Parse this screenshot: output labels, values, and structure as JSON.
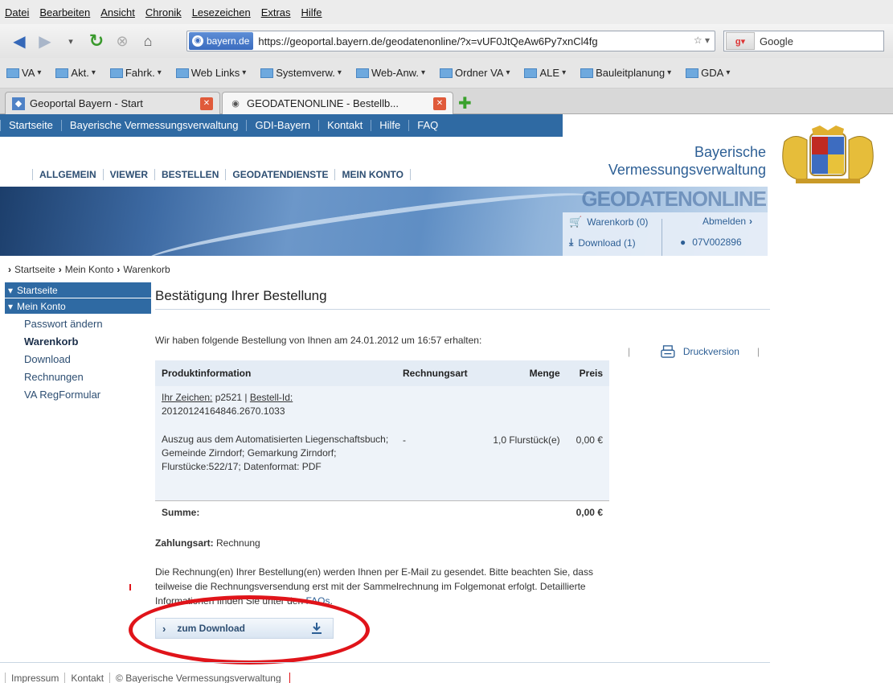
{
  "browser": {
    "menu": [
      {
        "label": "Datei"
      },
      {
        "label": "Bearbeiten"
      },
      {
        "label": "Ansicht"
      },
      {
        "label": "Chronik"
      },
      {
        "label": "Lesezeichen"
      },
      {
        "label": "Extras"
      },
      {
        "label": "Hilfe"
      }
    ],
    "site_badge": "bayern.de",
    "url": "https://geoportal.bayern.de/geodatenonline/?x=vUF0JtQeAw6Py7xnCl4fg",
    "search_engine": "Google",
    "bookmarks": [
      {
        "label": "VA"
      },
      {
        "label": "Akt."
      },
      {
        "label": "Fahrk."
      },
      {
        "label": "Web Links"
      },
      {
        "label": "Systemverw."
      },
      {
        "label": "Web-Anw."
      },
      {
        "label": "Ordner VA"
      },
      {
        "label": "ALE"
      },
      {
        "label": "Bauleitplanung"
      },
      {
        "label": "GDA"
      }
    ],
    "tabs": [
      {
        "title": "Geoportal Bayern - Start"
      },
      {
        "title": "GEODATENONLINE - Bestellb..."
      }
    ]
  },
  "page": {
    "topnav": [
      {
        "label": "Startseite"
      },
      {
        "label": "Bayerische Vermessungsverwaltung"
      },
      {
        "label": "GDI-Bayern"
      },
      {
        "label": "Kontakt"
      },
      {
        "label": "Hilfe"
      },
      {
        "label": "FAQ"
      }
    ],
    "logo": {
      "line1": "Bayerische",
      "line2": "Vermessungsverwaltung"
    },
    "mainnav": [
      {
        "label": "ALLGEMEIN"
      },
      {
        "label": "VIEWER"
      },
      {
        "label": "BESTELLEN"
      },
      {
        "label": "GEODATENDIENSTE"
      },
      {
        "label": "MEIN KONTO"
      }
    ],
    "banner": {
      "brand": "GEODATENONLINE",
      "cart": "Warenkorb (0)",
      "logout": "Abmelden",
      "download": "Download (1)",
      "user": "07V002896"
    },
    "breadcrumb": [
      "Startseite",
      "Mein Konto",
      "Warenkorb"
    ],
    "sidebar": {
      "head1": "Startseite",
      "head2": "Mein Konto",
      "items": [
        {
          "label": "Passwort ändern"
        },
        {
          "label": "Warenkorb"
        },
        {
          "label": "Download"
        },
        {
          "label": "Rechnungen"
        },
        {
          "label": "VA RegFormular"
        }
      ]
    },
    "content": {
      "title": "Bestätigung Ihrer Bestellung",
      "received": "Wir haben folgende Bestellung von Ihnen am 24.01.2012 um 16:57 erhalten:",
      "print": "Druckversion",
      "table": {
        "headers": {
          "product": "Produktinformation",
          "type": "Rechnungsart",
          "qty": "Menge",
          "price": "Preis"
        },
        "ref_label": "Ihr Zeichen:",
        "ref_value": " p2521 | ",
        "order_label": "Bestell-Id:",
        "order_id": "20120124164846.2670.1033",
        "product_desc": "Auszug aus dem Automatisierten Liegenschaftsbuch; Gemeinde Zirndorf; Gemarkung Zirndorf; Flurstücke:522/17; Datenformat: PDF",
        "type_value": "-",
        "qty_value": "1,0 Flurstück(e)",
        "price_value": "0,00 €",
        "sum_label": "Summe:",
        "sum_value": "0,00 €"
      },
      "payment_label": "Zahlungsart:",
      "payment_value": " Rechnung",
      "note_text": "Die Rechnung(en) Ihrer Bestellung(en) werden Ihnen per E-Mail zu gesendet. Bitte beachten Sie, dass teilweise die Rechnungsversendung erst mit der Sammelrechnung im Folgemonat erfolgt. Detaillierte Informationen finden Sie unter den ",
      "note_link": "FAQs",
      "note_end": ".",
      "download_button": "zum Download"
    },
    "footer": [
      {
        "label": "Impressum"
      },
      {
        "label": "Kontakt"
      },
      {
        "label": "© Bayerische Vermessungsverwaltung"
      }
    ],
    "colors": {
      "brand_blue": "#2f6aa3",
      "highlight_red": "#e0141a"
    }
  }
}
